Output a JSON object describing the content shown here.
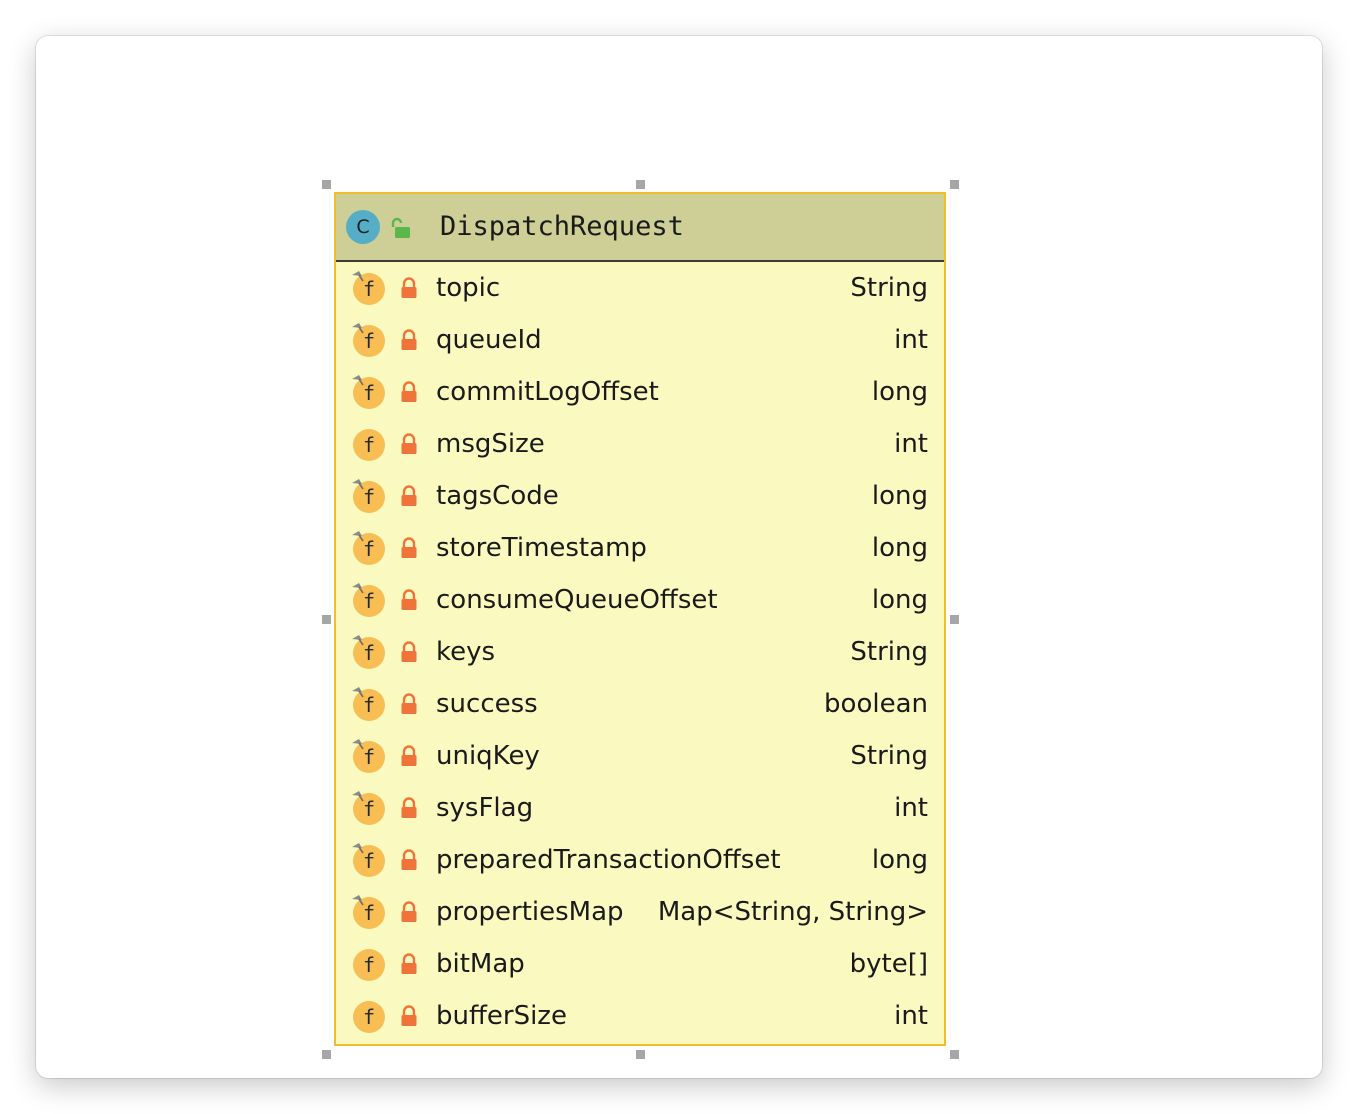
{
  "diagram": {
    "class": {
      "kind_icon": "class-icon",
      "kind_letter": "C",
      "visibility_icon": "unlocked-icon",
      "name": "DispatchRequest"
    },
    "fields": [
      {
        "name": "topic",
        "type": "String",
        "final": true
      },
      {
        "name": "queueId",
        "type": "int",
        "final": true
      },
      {
        "name": "commitLogOffset",
        "type": "long",
        "final": true
      },
      {
        "name": "msgSize",
        "type": "int",
        "final": false
      },
      {
        "name": "tagsCode",
        "type": "long",
        "final": true
      },
      {
        "name": "storeTimestamp",
        "type": "long",
        "final": true
      },
      {
        "name": "consumeQueueOffset",
        "type": "long",
        "final": true
      },
      {
        "name": "keys",
        "type": "String",
        "final": true
      },
      {
        "name": "success",
        "type": "boolean",
        "final": true
      },
      {
        "name": "uniqKey",
        "type": "String",
        "final": true
      },
      {
        "name": "sysFlag",
        "type": "int",
        "final": true
      },
      {
        "name": "preparedTransactionOffset",
        "type": "long",
        "final": true
      },
      {
        "name": "propertiesMap",
        "type": "Map<String, String>",
        "final": true
      },
      {
        "name": "bitMap",
        "type": "byte[]",
        "final": false
      },
      {
        "name": "bufferSize",
        "type": "int",
        "final": false
      }
    ],
    "field_icon_letter": "f",
    "colors": {
      "box_border": "#f2bf2c",
      "box_fill": "#fafac0",
      "header_fill": "#cdcf96",
      "class_icon": "#56aec6",
      "field_icon": "#f8be53",
      "lock": "#f0743a",
      "unlock": "#5ab74a"
    }
  }
}
